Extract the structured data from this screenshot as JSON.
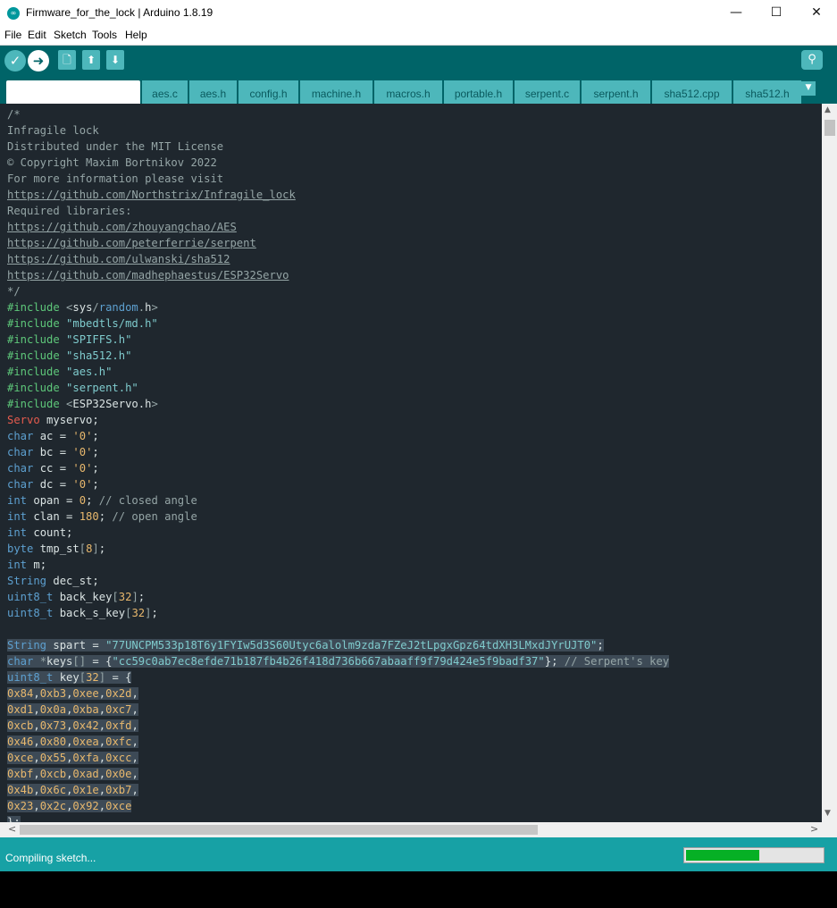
{
  "window": {
    "title": "Firmware_for_the_lock | Arduino 1.8.19",
    "app_icon": "arduino-logo-icon",
    "minimize": "—",
    "maximize": "☐",
    "close": "✕"
  },
  "menu": [
    "File",
    "Edit",
    "Sketch",
    "Tools",
    "Help"
  ],
  "toolbar": {
    "verify_icon": "✓",
    "upload_icon": "➜",
    "new_icon": "🗋",
    "open_icon": "⬆",
    "save_icon": "⬇",
    "serial_monitor_icon": "⚲"
  },
  "tabs": [
    "",
    "aes.c",
    "aes.h",
    "config.h",
    "machine.h",
    "macros.h",
    "portable.h",
    "serpent.c",
    "serpent.h",
    "sha512.cpp",
    "sha512.h"
  ],
  "tab_menu_icon": "▼",
  "colors": {
    "toolbar": "#006468",
    "tab": "#4db7bb",
    "editor_bg": "#1f272e",
    "status_bar": "#17a1a5",
    "progress": "#06b025"
  },
  "code_lines": [
    {
      "segs": [
        {
          "c": "cm",
          "t": "/*"
        }
      ]
    },
    {
      "segs": [
        {
          "c": "cm",
          "t": "Infragile lock"
        }
      ]
    },
    {
      "segs": [
        {
          "c": "cm",
          "t": "Distributed under the MIT License"
        }
      ]
    },
    {
      "segs": [
        {
          "c": "cm",
          "t": "© Copyright Maxim Bortnikov 2022"
        }
      ]
    },
    {
      "segs": [
        {
          "c": "cm",
          "t": "For more information please visit"
        }
      ]
    },
    {
      "segs": [
        {
          "c": "lnk",
          "t": "https://github.com/Northstrix/Infragile_lock"
        }
      ]
    },
    {
      "segs": [
        {
          "c": "cm",
          "t": "Required libraries:"
        }
      ]
    },
    {
      "segs": [
        {
          "c": "lnk",
          "t": "https://github.com/zhouyangchao/AES"
        }
      ]
    },
    {
      "segs": [
        {
          "c": "lnk",
          "t": "https://github.com/peterferrie/serpent"
        }
      ]
    },
    {
      "segs": [
        {
          "c": "lnk",
          "t": "https://github.com/ulwanski/sha512"
        }
      ]
    },
    {
      "segs": [
        {
          "c": "lnk",
          "t": "https://github.com/madhephaestus/ESP32Servo"
        }
      ]
    },
    {
      "segs": [
        {
          "c": "cm",
          "t": "*/"
        }
      ]
    },
    {
      "segs": [
        {
          "c": "pp",
          "t": "#include "
        },
        {
          "c": "cm",
          "t": "<"
        },
        {
          "c": "pn",
          "t": "sys"
        },
        {
          "c": "cm",
          "t": "/"
        },
        {
          "c": "typ",
          "t": "random"
        },
        {
          "c": "cm",
          "t": "."
        },
        {
          "c": "pn",
          "t": "h"
        },
        {
          "c": "cm",
          "t": ">"
        }
      ]
    },
    {
      "segs": [
        {
          "c": "pp",
          "t": "#include "
        },
        {
          "c": "str",
          "t": "\"mbedtls/md.h\""
        }
      ]
    },
    {
      "segs": [
        {
          "c": "pp",
          "t": "#include "
        },
        {
          "c": "str",
          "t": "\"SPIFFS.h\""
        }
      ]
    },
    {
      "segs": [
        {
          "c": "pp",
          "t": "#include "
        },
        {
          "c": "str",
          "t": "\"sha512.h\""
        }
      ]
    },
    {
      "segs": [
        {
          "c": "pp",
          "t": "#include "
        },
        {
          "c": "str",
          "t": "\"aes.h\""
        }
      ]
    },
    {
      "segs": [
        {
          "c": "pp",
          "t": "#include "
        },
        {
          "c": "str",
          "t": "\"serpent.h\""
        }
      ]
    },
    {
      "segs": [
        {
          "c": "pp",
          "t": "#include "
        },
        {
          "c": "cm",
          "t": "<"
        },
        {
          "c": "pn",
          "t": "ESP32Servo.h"
        },
        {
          "c": "cm",
          "t": ">"
        }
      ]
    },
    {
      "segs": [
        {
          "c": "tp",
          "t": "Servo"
        },
        {
          "c": "pn",
          "t": " myservo;"
        }
      ]
    },
    {
      "segs": [
        {
          "c": "typ",
          "t": "char"
        },
        {
          "c": "pn",
          "t": " ac = "
        },
        {
          "c": "num",
          "t": "'0'"
        },
        {
          "c": "pn",
          "t": ";"
        }
      ]
    },
    {
      "segs": [
        {
          "c": "typ",
          "t": "char"
        },
        {
          "c": "pn",
          "t": " bc = "
        },
        {
          "c": "num",
          "t": "'0'"
        },
        {
          "c": "pn",
          "t": ";"
        }
      ]
    },
    {
      "segs": [
        {
          "c": "typ",
          "t": "char"
        },
        {
          "c": "pn",
          "t": " cc = "
        },
        {
          "c": "num",
          "t": "'0'"
        },
        {
          "c": "pn",
          "t": ";"
        }
      ]
    },
    {
      "segs": [
        {
          "c": "typ",
          "t": "char"
        },
        {
          "c": "pn",
          "t": " dc = "
        },
        {
          "c": "num",
          "t": "'0'"
        },
        {
          "c": "pn",
          "t": ";"
        }
      ]
    },
    {
      "segs": [
        {
          "c": "typ",
          "t": "int"
        },
        {
          "c": "pn",
          "t": " opan = "
        },
        {
          "c": "num",
          "t": "0"
        },
        {
          "c": "pn",
          "t": "; "
        },
        {
          "c": "cm",
          "t": "// closed angle"
        }
      ]
    },
    {
      "segs": [
        {
          "c": "typ",
          "t": "int"
        },
        {
          "c": "pn",
          "t": " clan = "
        },
        {
          "c": "num",
          "t": "180"
        },
        {
          "c": "pn",
          "t": "; "
        },
        {
          "c": "cm",
          "t": "// open angle"
        }
      ]
    },
    {
      "segs": [
        {
          "c": "typ",
          "t": "int"
        },
        {
          "c": "pn",
          "t": " count;"
        }
      ]
    },
    {
      "segs": [
        {
          "c": "typ",
          "t": "byte"
        },
        {
          "c": "pn",
          "t": " tmp_st"
        },
        {
          "c": "cm",
          "t": "["
        },
        {
          "c": "num",
          "t": "8"
        },
        {
          "c": "cm",
          "t": "]"
        },
        {
          "c": "pn",
          "t": ";"
        }
      ]
    },
    {
      "segs": [
        {
          "c": "typ",
          "t": "int"
        },
        {
          "c": "pn",
          "t": " m;"
        }
      ]
    },
    {
      "segs": [
        {
          "c": "typ",
          "t": "String"
        },
        {
          "c": "pn",
          "t": " dec_st;"
        }
      ]
    },
    {
      "segs": [
        {
          "c": "typ",
          "t": "uint8_t"
        },
        {
          "c": "pn",
          "t": " back_key"
        },
        {
          "c": "cm",
          "t": "["
        },
        {
          "c": "num",
          "t": "32"
        },
        {
          "c": "cm",
          "t": "]"
        },
        {
          "c": "pn",
          "t": ";"
        }
      ]
    },
    {
      "segs": [
        {
          "c": "typ",
          "t": "uint8_t"
        },
        {
          "c": "pn",
          "t": " back_s_key"
        },
        {
          "c": "cm",
          "t": "["
        },
        {
          "c": "num",
          "t": "32"
        },
        {
          "c": "cm",
          "t": "]"
        },
        {
          "c": "pn",
          "t": ";"
        }
      ]
    },
    {
      "segs": [
        {
          "c": "pn",
          "t": ""
        }
      ]
    },
    {
      "sel": true,
      "segs": [
        {
          "c": "typ",
          "t": "String"
        },
        {
          "c": "pn",
          "t": " spart = "
        },
        {
          "c": "str",
          "t": "\"77UNCPM533p18T6y1FYIw5d3S60Utyc6alolm9zda7FZeJ2tLpgxGpz64tdXH3LMxdJYrUJT0\""
        },
        {
          "c": "pn",
          "t": ";"
        }
      ]
    },
    {
      "sel": true,
      "segs": [
        {
          "c": "typ",
          "t": "char"
        },
        {
          "c": "pn",
          "t": " "
        },
        {
          "c": "cm",
          "t": "*"
        },
        {
          "c": "pn",
          "t": "keys"
        },
        {
          "c": "cm",
          "t": "[]"
        },
        {
          "c": "pn",
          "t": " = {"
        },
        {
          "c": "str",
          "t": "\"cc59c0ab7ec8efde71b187fb4b26f418d736b667abaaff9f79d424e5f9badf37\""
        },
        {
          "c": "pn",
          "t": "}; "
        },
        {
          "c": "cm",
          "t": "// Serpent's key"
        }
      ]
    },
    {
      "sel": true,
      "segs": [
        {
          "c": "typ",
          "t": "uint8_t"
        },
        {
          "c": "pn",
          "t": " key"
        },
        {
          "c": "cm",
          "t": "["
        },
        {
          "c": "num",
          "t": "32"
        },
        {
          "c": "cm",
          "t": "]"
        },
        {
          "c": "pn",
          "t": " = {"
        }
      ]
    },
    {
      "sel": true,
      "segs": [
        {
          "c": "num",
          "t": "0x84"
        },
        {
          "c": "pn",
          "t": ","
        },
        {
          "c": "num",
          "t": "0xb3"
        },
        {
          "c": "pn",
          "t": ","
        },
        {
          "c": "num",
          "t": "0xee"
        },
        {
          "c": "pn",
          "t": ","
        },
        {
          "c": "num",
          "t": "0x2d"
        },
        {
          "c": "pn",
          "t": ","
        }
      ]
    },
    {
      "sel": true,
      "segs": [
        {
          "c": "num",
          "t": "0xd1"
        },
        {
          "c": "pn",
          "t": ","
        },
        {
          "c": "num",
          "t": "0x0a"
        },
        {
          "c": "pn",
          "t": ","
        },
        {
          "c": "num",
          "t": "0xba"
        },
        {
          "c": "pn",
          "t": ","
        },
        {
          "c": "num",
          "t": "0xc7"
        },
        {
          "c": "pn",
          "t": ","
        }
      ]
    },
    {
      "sel": true,
      "segs": [
        {
          "c": "num",
          "t": "0xcb"
        },
        {
          "c": "pn",
          "t": ","
        },
        {
          "c": "num",
          "t": "0x73"
        },
        {
          "c": "pn",
          "t": ","
        },
        {
          "c": "num",
          "t": "0x42"
        },
        {
          "c": "pn",
          "t": ","
        },
        {
          "c": "num",
          "t": "0xfd"
        },
        {
          "c": "pn",
          "t": ","
        }
      ]
    },
    {
      "sel": true,
      "segs": [
        {
          "c": "num",
          "t": "0x46"
        },
        {
          "c": "pn",
          "t": ","
        },
        {
          "c": "num",
          "t": "0x80"
        },
        {
          "c": "pn",
          "t": ","
        },
        {
          "c": "num",
          "t": "0xea"
        },
        {
          "c": "pn",
          "t": ","
        },
        {
          "c": "num",
          "t": "0xfc"
        },
        {
          "c": "pn",
          "t": ","
        }
      ]
    },
    {
      "sel": true,
      "segs": [
        {
          "c": "num",
          "t": "0xce"
        },
        {
          "c": "pn",
          "t": ","
        },
        {
          "c": "num",
          "t": "0x55"
        },
        {
          "c": "pn",
          "t": ","
        },
        {
          "c": "num",
          "t": "0xfa"
        },
        {
          "c": "pn",
          "t": ","
        },
        {
          "c": "num",
          "t": "0xcc"
        },
        {
          "c": "pn",
          "t": ","
        }
      ]
    },
    {
      "sel": true,
      "segs": [
        {
          "c": "num",
          "t": "0xbf"
        },
        {
          "c": "pn",
          "t": ","
        },
        {
          "c": "num",
          "t": "0xcb"
        },
        {
          "c": "pn",
          "t": ","
        },
        {
          "c": "num",
          "t": "0xad"
        },
        {
          "c": "pn",
          "t": ","
        },
        {
          "c": "num",
          "t": "0x0e"
        },
        {
          "c": "pn",
          "t": ","
        }
      ]
    },
    {
      "sel": true,
      "segs": [
        {
          "c": "num",
          "t": "0x4b"
        },
        {
          "c": "pn",
          "t": ","
        },
        {
          "c": "num",
          "t": "0x6c"
        },
        {
          "c": "pn",
          "t": ","
        },
        {
          "c": "num",
          "t": "0x1e"
        },
        {
          "c": "pn",
          "t": ","
        },
        {
          "c": "num",
          "t": "0xb7"
        },
        {
          "c": "pn",
          "t": ","
        }
      ]
    },
    {
      "sel": true,
      "segs": [
        {
          "c": "num",
          "t": "0x23"
        },
        {
          "c": "pn",
          "t": ","
        },
        {
          "c": "num",
          "t": "0x2c"
        },
        {
          "c": "pn",
          "t": ","
        },
        {
          "c": "num",
          "t": "0x92"
        },
        {
          "c": "pn",
          "t": ","
        },
        {
          "c": "num",
          "t": "0xce"
        }
      ]
    },
    {
      "sel": true,
      "segs": [
        {
          "c": "pn",
          "t": "};"
        }
      ]
    }
  ],
  "scroll": {
    "up": "▲",
    "down": "▼",
    "left": "<",
    "right": ">"
  },
  "status": {
    "text": "Compiling sketch...",
    "progress": 0.54
  }
}
